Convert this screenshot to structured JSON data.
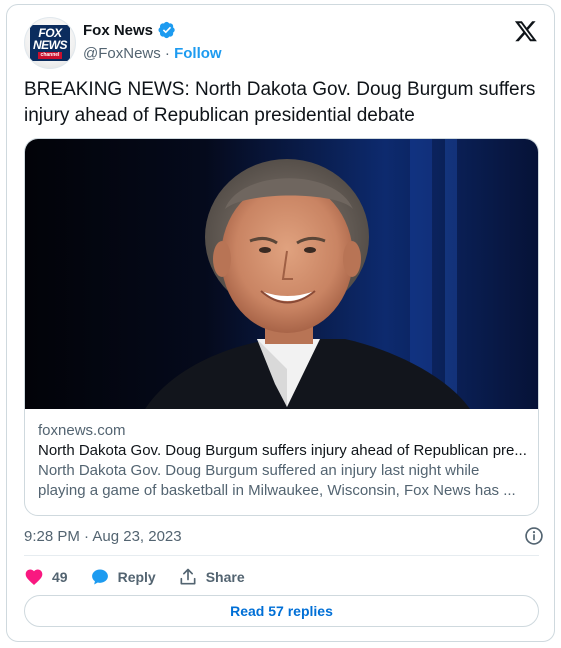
{
  "account": {
    "name": "Fox News",
    "handle": "@FoxNews",
    "separator": " · ",
    "follow_label": "Follow",
    "logo_text": [
      "FOX",
      "NEWS",
      "channel"
    ]
  },
  "tweet": {
    "text": "BREAKING NEWS: North Dakota Gov. Doug Burgum suffers injury ahead of Republican presidential debate"
  },
  "link_card": {
    "domain": "foxnews.com",
    "title": "North Dakota Gov. Doug Burgum suffers injury ahead of Republican pre...",
    "description_line1": "North Dakota Gov. Doug Burgum suffered an injury last night while",
    "description_line2": "playing a game of basketball in Milwaukee, Wisconsin, Fox News has ..."
  },
  "meta": {
    "timestamp": "9:28 PM · Aug 23, 2023"
  },
  "actions": {
    "like_count": "49",
    "reply_label": "Reply",
    "share_label": "Share"
  },
  "replies_button": "Read 57 replies",
  "colors": {
    "accent": "#1d9bf0",
    "like": "#f91880",
    "link_blue": "#006fd6",
    "muted": "#536471",
    "border": "#cfd9de"
  },
  "icons": [
    "verified-badge-icon",
    "x-logo-icon",
    "info-icon",
    "heart-icon",
    "reply-bubble-icon",
    "share-icon"
  ]
}
